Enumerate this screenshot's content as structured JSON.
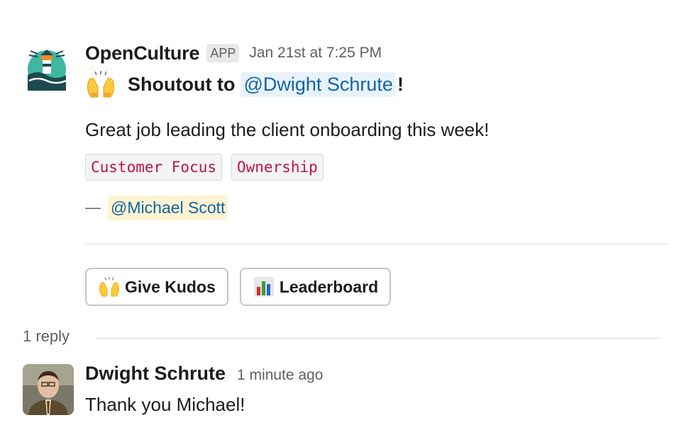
{
  "message": {
    "sender": "OpenCulture",
    "badge": "APP",
    "timestamp": "Jan 21st at 7:25 PM",
    "avatar_icon": "lighthouse-logo",
    "shoutout_prefix": "Shoutout to",
    "shoutout_mention": "@Dwight Schrute",
    "shoutout_suffix": "!",
    "body": "Great job leading the client onboarding this week!",
    "tags": [
      "Customer Focus",
      "Ownership"
    ],
    "signoff_dash": "—",
    "signoff_mention": "@Michael Scott"
  },
  "actions": {
    "give_kudos": "Give Kudos",
    "give_kudos_icon": "raising-hands-icon",
    "leaderboard": "Leaderboard",
    "leaderboard_icon": "bar-chart-icon"
  },
  "thread": {
    "reply_count": "1 reply"
  },
  "reply": {
    "sender": "Dwight Schrute",
    "timestamp": "1 minute ago",
    "text": "Thank you Michael!"
  },
  "colors": {
    "mention_text": "#1264a3",
    "mention_bg": "#e8f2fb",
    "mention_highlight_bg": "#fdf3d3",
    "tag_text": "#c01343",
    "muted_text": "#616061"
  }
}
